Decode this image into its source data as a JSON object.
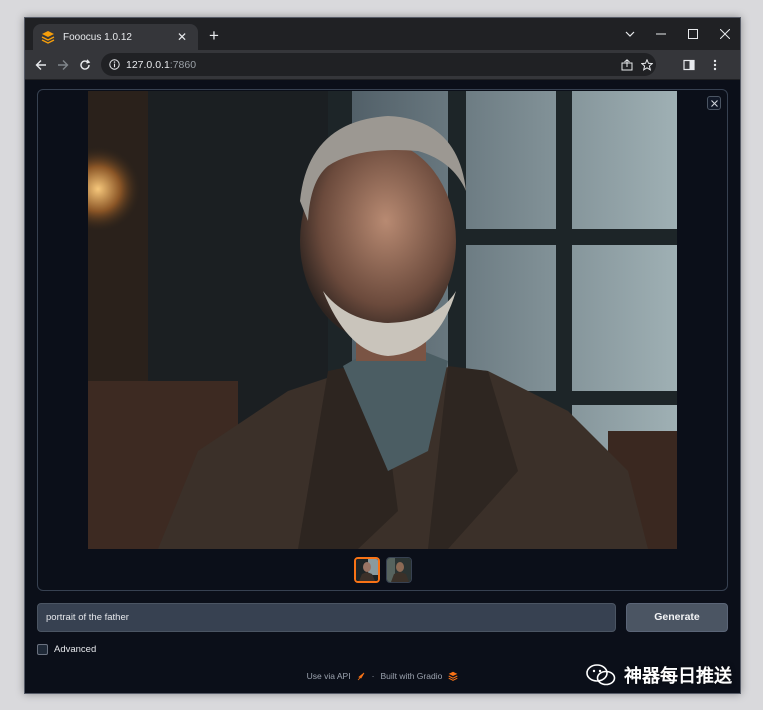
{
  "browser": {
    "tab_title": "Fooocus 1.0.12",
    "new_tab_label": "+",
    "url_host": "127.0.0.1",
    "url_port": ":7860"
  },
  "app": {
    "prompt_value": "portrait of the father",
    "generate_label": "Generate",
    "advanced_label": "Advanced",
    "footer_api": "Use via API",
    "footer_separator": "·",
    "footer_built": "Built with Gradio",
    "accent_color": "#f97316"
  },
  "watermark": {
    "text": "神器每日推送"
  }
}
